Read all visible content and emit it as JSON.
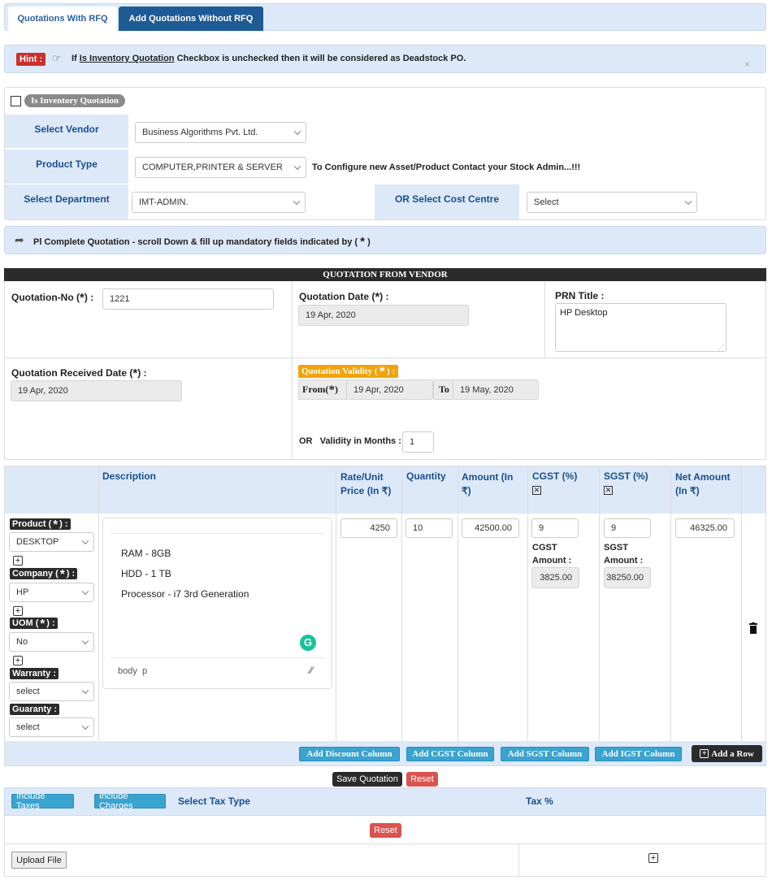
{
  "tabs": [
    {
      "label": "Quotations With RFQ"
    },
    {
      "label": "Add Quotations Without RFQ"
    }
  ],
  "hint": {
    "badge": "Hint :",
    "pre": "If ",
    "link": "Is Inventory Quotation",
    "post": " Checkbox is unchecked then it will be considered as Deadstock PO.",
    "close": "×"
  },
  "inventory": {
    "label": "Is Inventory Quotation"
  },
  "vendor": {
    "label": "Select Vendor",
    "value": "Business Algorithms Pvt. Ltd."
  },
  "product_type": {
    "label": "Product Type",
    "value": "COMPUTER,PRINTER & SERVER",
    "note": "To Configure new Asset/Product Contact your Stock Admin...!!!"
  },
  "department": {
    "label": "Select Department",
    "value": "IMT-ADMIN.",
    "cost_centre_label": "OR Select Cost Centre",
    "cost_centre_value": "Select"
  },
  "complete_note": {
    "text": "Pl Complete Quotation - scroll Down & fill up mandatory fields indicated by (",
    "star": "*",
    "close": ")"
  },
  "quotation": {
    "header": "QUOTATION FROM VENDOR",
    "no_label": "Quotation-No (",
    "no_value": "1221",
    "date_label": "Quotation Date (",
    "date_value": "19 Apr, 2020",
    "prn_label": "PRN Title :",
    "prn_value": "HP Desktop",
    "recv_label": "Quotation Received Date (",
    "recv_value": "19 Apr, 2020",
    "validity_label": "Quotation Validity (",
    "from_label": "From(",
    "from_value": "19 Apr, 2020",
    "to_label": "To",
    "to_value": "19 May, 2020",
    "months_label": "OR   Validity in Months :",
    "months_value": "1",
    "star": "*",
    "close_colon": ") :",
    "close_paren": ")"
  },
  "table": {
    "headers": {
      "description": "Description",
      "rate": "Rate/Unit Price (In ₹)",
      "quantity": "Quantity",
      "amount": "Amount (In ₹)",
      "cgst": "CGST (%)",
      "sgst": "SGST (%)",
      "net": "Net Amount (In ₹)"
    },
    "row": {
      "product_label": "Product (",
      "product_value": "DESKTOP",
      "company_label": "Company (",
      "company_value": "HP",
      "uom_label": "UOM (",
      "uom_value": "No",
      "warranty_label": "Warranty :",
      "warranty_value": "select",
      "guaranty_label": "Guaranty :",
      "guaranty_value": "select",
      "star": "*",
      "close": ") :",
      "description_lines": [
        "RAM - 8GB",
        "HDD - 1 TB",
        "Processor - i7 3rd Generation"
      ],
      "editor_path": "body  p",
      "rate": "4250",
      "quantity": "10",
      "amount": "42500.00",
      "cgst": "9",
      "cgst_amount_label": "CGST Amount :",
      "cgst_amount": "3825.00",
      "sgst": "9",
      "sgst_amount_label": "SGST Amount :",
      "sgst_amount": "38250.00",
      "net": "46325.00"
    }
  },
  "buttons": {
    "add_discount": "Add Discount Column",
    "add_cgst": "Add CGST Column",
    "add_sgst": "Add SGST Column",
    "add_igst": "Add IGST Column",
    "add_row": "Add a Row",
    "save": "Save Quotation",
    "reset": "Reset",
    "include_taxes": "Include Taxes",
    "include_charges": "Include Charges",
    "reset2": "Reset",
    "upload": "Upload File"
  },
  "tax": {
    "type_label": "Select Tax Type",
    "percent_label": "Tax %"
  }
}
